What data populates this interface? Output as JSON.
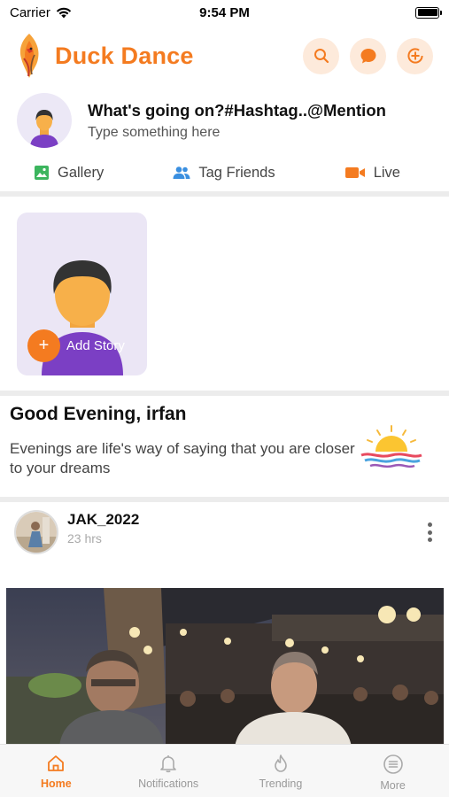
{
  "status_bar": {
    "carrier": "Carrier",
    "time": "9:54 PM"
  },
  "header": {
    "brand": "Duck Dance",
    "brand_color": "#f47b20",
    "actions": [
      {
        "icon": "search-icon"
      },
      {
        "icon": "chat-bubble-icon"
      },
      {
        "icon": "add-circle-icon"
      }
    ]
  },
  "composer": {
    "title": "What's going on?#Hashtag..@Mention",
    "placeholder": "Type something here"
  },
  "quick_actions": [
    {
      "label": "Gallery",
      "icon": "gallery-icon",
      "color": "#3cb55e"
    },
    {
      "label": "Tag Friends",
      "icon": "people-icon",
      "color": "#3a8fe0"
    },
    {
      "label": "Live",
      "icon": "video-camera-icon",
      "color": "#f47b20"
    }
  ],
  "stories": {
    "add_label": "Add Story"
  },
  "greeting": {
    "title": "Good Evening, irfan",
    "message": "Evenings are life's way of saying that you are closer to your dreams"
  },
  "post": {
    "username": "JAK_2022",
    "time": "23 hrs"
  },
  "bottom_nav": [
    {
      "label": "Home",
      "icon": "home-icon",
      "active": true
    },
    {
      "label": "Notifications",
      "icon": "bell-icon",
      "active": false
    },
    {
      "label": "Trending",
      "icon": "flame-icon",
      "active": false
    },
    {
      "label": "More",
      "icon": "menu-icon",
      "active": false
    }
  ]
}
